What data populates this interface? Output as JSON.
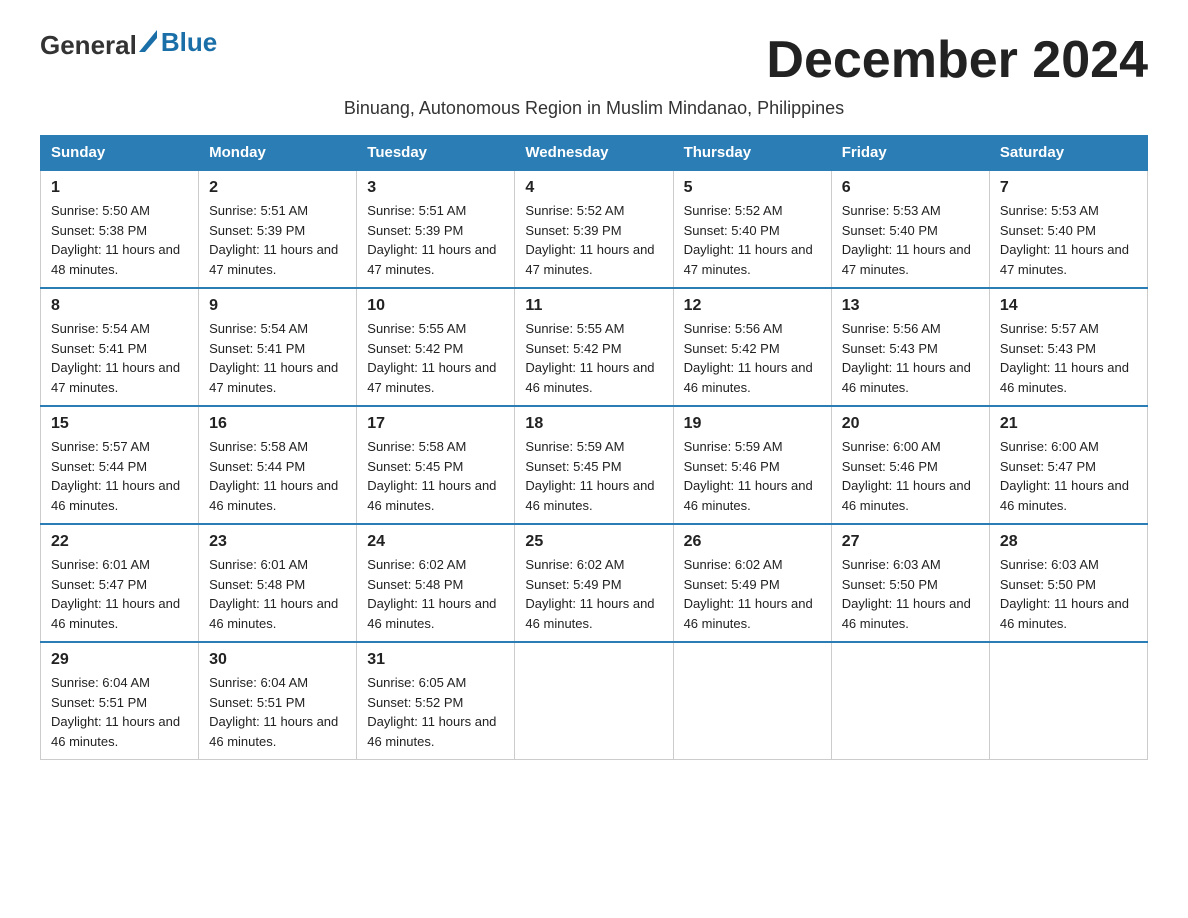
{
  "logo": {
    "text_general": "General",
    "text_blue": "Blue"
  },
  "title": "December 2024",
  "subtitle": "Binuang, Autonomous Region in Muslim Mindanao, Philippines",
  "header": {
    "days": [
      "Sunday",
      "Monday",
      "Tuesday",
      "Wednesday",
      "Thursday",
      "Friday",
      "Saturday"
    ]
  },
  "weeks": [
    [
      {
        "day": 1,
        "sunrise": "5:50 AM",
        "sunset": "5:38 PM",
        "daylight": "11 hours and 48 minutes."
      },
      {
        "day": 2,
        "sunrise": "5:51 AM",
        "sunset": "5:39 PM",
        "daylight": "11 hours and 47 minutes."
      },
      {
        "day": 3,
        "sunrise": "5:51 AM",
        "sunset": "5:39 PM",
        "daylight": "11 hours and 47 minutes."
      },
      {
        "day": 4,
        "sunrise": "5:52 AM",
        "sunset": "5:39 PM",
        "daylight": "11 hours and 47 minutes."
      },
      {
        "day": 5,
        "sunrise": "5:52 AM",
        "sunset": "5:40 PM",
        "daylight": "11 hours and 47 minutes."
      },
      {
        "day": 6,
        "sunrise": "5:53 AM",
        "sunset": "5:40 PM",
        "daylight": "11 hours and 47 minutes."
      },
      {
        "day": 7,
        "sunrise": "5:53 AM",
        "sunset": "5:40 PM",
        "daylight": "11 hours and 47 minutes."
      }
    ],
    [
      {
        "day": 8,
        "sunrise": "5:54 AM",
        "sunset": "5:41 PM",
        "daylight": "11 hours and 47 minutes."
      },
      {
        "day": 9,
        "sunrise": "5:54 AM",
        "sunset": "5:41 PM",
        "daylight": "11 hours and 47 minutes."
      },
      {
        "day": 10,
        "sunrise": "5:55 AM",
        "sunset": "5:42 PM",
        "daylight": "11 hours and 47 minutes."
      },
      {
        "day": 11,
        "sunrise": "5:55 AM",
        "sunset": "5:42 PM",
        "daylight": "11 hours and 46 minutes."
      },
      {
        "day": 12,
        "sunrise": "5:56 AM",
        "sunset": "5:42 PM",
        "daylight": "11 hours and 46 minutes."
      },
      {
        "day": 13,
        "sunrise": "5:56 AM",
        "sunset": "5:43 PM",
        "daylight": "11 hours and 46 minutes."
      },
      {
        "day": 14,
        "sunrise": "5:57 AM",
        "sunset": "5:43 PM",
        "daylight": "11 hours and 46 minutes."
      }
    ],
    [
      {
        "day": 15,
        "sunrise": "5:57 AM",
        "sunset": "5:44 PM",
        "daylight": "11 hours and 46 minutes."
      },
      {
        "day": 16,
        "sunrise": "5:58 AM",
        "sunset": "5:44 PM",
        "daylight": "11 hours and 46 minutes."
      },
      {
        "day": 17,
        "sunrise": "5:58 AM",
        "sunset": "5:45 PM",
        "daylight": "11 hours and 46 minutes."
      },
      {
        "day": 18,
        "sunrise": "5:59 AM",
        "sunset": "5:45 PM",
        "daylight": "11 hours and 46 minutes."
      },
      {
        "day": 19,
        "sunrise": "5:59 AM",
        "sunset": "5:46 PM",
        "daylight": "11 hours and 46 minutes."
      },
      {
        "day": 20,
        "sunrise": "6:00 AM",
        "sunset": "5:46 PM",
        "daylight": "11 hours and 46 minutes."
      },
      {
        "day": 21,
        "sunrise": "6:00 AM",
        "sunset": "5:47 PM",
        "daylight": "11 hours and 46 minutes."
      }
    ],
    [
      {
        "day": 22,
        "sunrise": "6:01 AM",
        "sunset": "5:47 PM",
        "daylight": "11 hours and 46 minutes."
      },
      {
        "day": 23,
        "sunrise": "6:01 AM",
        "sunset": "5:48 PM",
        "daylight": "11 hours and 46 minutes."
      },
      {
        "day": 24,
        "sunrise": "6:02 AM",
        "sunset": "5:48 PM",
        "daylight": "11 hours and 46 minutes."
      },
      {
        "day": 25,
        "sunrise": "6:02 AM",
        "sunset": "5:49 PM",
        "daylight": "11 hours and 46 minutes."
      },
      {
        "day": 26,
        "sunrise": "6:02 AM",
        "sunset": "5:49 PM",
        "daylight": "11 hours and 46 minutes."
      },
      {
        "day": 27,
        "sunrise": "6:03 AM",
        "sunset": "5:50 PM",
        "daylight": "11 hours and 46 minutes."
      },
      {
        "day": 28,
        "sunrise": "6:03 AM",
        "sunset": "5:50 PM",
        "daylight": "11 hours and 46 minutes."
      }
    ],
    [
      {
        "day": 29,
        "sunrise": "6:04 AM",
        "sunset": "5:51 PM",
        "daylight": "11 hours and 46 minutes."
      },
      {
        "day": 30,
        "sunrise": "6:04 AM",
        "sunset": "5:51 PM",
        "daylight": "11 hours and 46 minutes."
      },
      {
        "day": 31,
        "sunrise": "6:05 AM",
        "sunset": "5:52 PM",
        "daylight": "11 hours and 46 minutes."
      },
      null,
      null,
      null,
      null
    ]
  ],
  "colors": {
    "header_bg": "#2a7db5",
    "header_text": "#ffffff",
    "border": "#cccccc",
    "text": "#222222"
  }
}
